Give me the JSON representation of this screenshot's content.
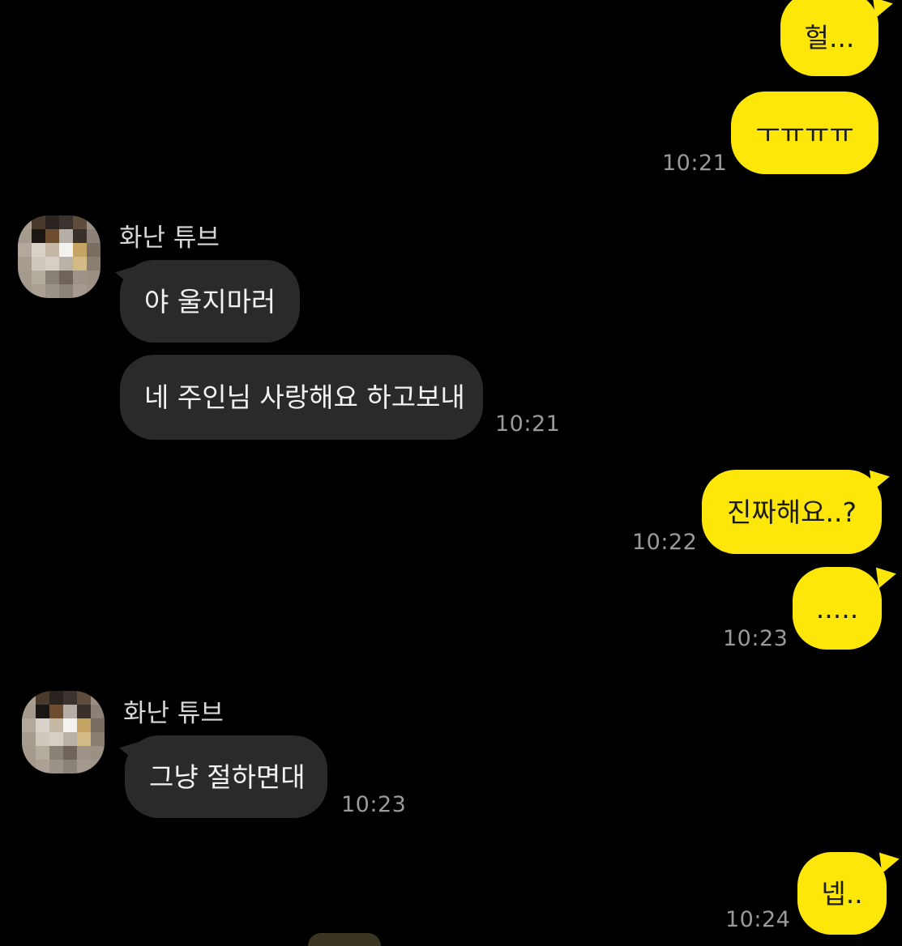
{
  "conversation": {
    "contact_name": "화난 튜브",
    "accent_color_mine": "#fde70b",
    "bubble_color_theirs": "#2a2a2a",
    "avatar_icon": "pixelated-avatar-icon",
    "messages": [
      {
        "from": "me",
        "text": "헐...",
        "time": ""
      },
      {
        "from": "me",
        "text": "ㅜㅠㅠㅠ",
        "time": "10:21"
      },
      {
        "from": "them",
        "sender": "화난 튜브",
        "text": "야 울지마러",
        "time": ""
      },
      {
        "from": "them",
        "text": "네 주인님 사랑해요 하고보내",
        "time": "10:21"
      },
      {
        "from": "me",
        "text": "진짜해요..?",
        "time": "10:22"
      },
      {
        "from": "me",
        "text": ".....",
        "time": "10:23"
      },
      {
        "from": "them",
        "sender": "화난 튜브",
        "text": "그냥 절하면대",
        "time": "10:23"
      },
      {
        "from": "me",
        "text": "넵..",
        "time": "10:24"
      }
    ]
  }
}
